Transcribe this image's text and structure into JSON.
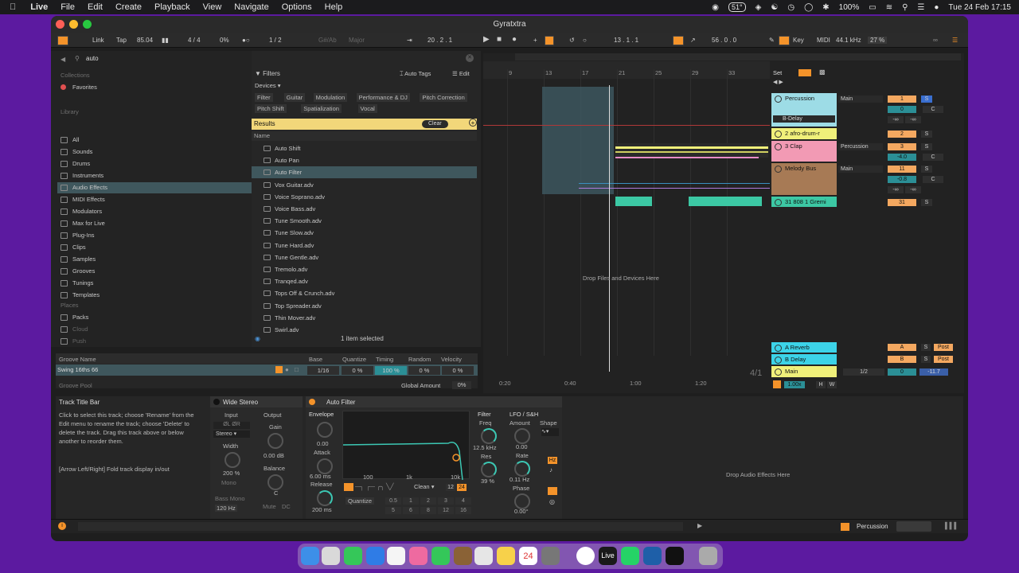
{
  "menubar": {
    "app": "Live",
    "items": [
      "File",
      "Edit",
      "Create",
      "Playback",
      "View",
      "Navigate",
      "Options",
      "Help"
    ],
    "temp": "51°",
    "battery": "100%",
    "datetime": "Tue 24 Feb  17:15"
  },
  "window": {
    "title": "Gyratxtra"
  },
  "transport": {
    "link": "Link",
    "tap": "Tap",
    "tempo": "85.04",
    "signature": "4 / 4",
    "groove_pct": "0%",
    "quant": "1 / 2",
    "key_ph": "G#/Ab",
    "scale": "Major",
    "pos1": "20 .  2 .  1",
    "pos2": "13 .  1 .  1",
    "pos3": "56 .  0 .  0",
    "key": "Key",
    "midi": "MIDI",
    "sample_rate": "44.1 kHz",
    "cpu": "27 %"
  },
  "browser": {
    "search": "auto",
    "collections_hdr": "Collections",
    "favorites": "Favorites",
    "library_hdr": "Library",
    "library": [
      "All",
      "Sounds",
      "Drums",
      "Instruments",
      "Audio Effects",
      "MIDI Effects",
      "Modulators",
      "Max for Live",
      "Plug-Ins",
      "Clips",
      "Samples",
      "Grooves",
      "Tunings",
      "Templates"
    ],
    "places_hdr": "Places",
    "places": [
      "Packs",
      "Cloud",
      "Push"
    ],
    "filters": "Filters",
    "auto_tags": "Auto Tags",
    "edit": "Edit",
    "devices_filter": "Devices",
    "tags1": [
      "Filter",
      "Guitar",
      "Modulation",
      "Performance & DJ",
      "Pitch Correction"
    ],
    "tags2": [
      "Pitch Shift",
      "Spatialization",
      "Vocal"
    ],
    "results": "Results",
    "clear": "Clear",
    "name_col": "Name",
    "results_list": [
      "Auto Shift",
      "Auto Pan",
      "Auto Filter",
      "Vox Guitar.adv",
      "Voice Soprano.adv",
      "Voice Bass.adv",
      "Tune Smooth.adv",
      "Tune Slow.adv",
      "Tune Hard.adv",
      "Tune Gentle.adv",
      "Tremolo.adv",
      "Tranqed.adv",
      "Tops Off & Crunch.adv",
      "Top Spreader.adv",
      "Thin Mover.adv",
      "Swirl.adv"
    ],
    "footer": "1 item selected"
  },
  "groove": {
    "hdr_name": "Groove Name",
    "hdr_base": "Base",
    "hdr_quantize": "Quantize",
    "hdr_timing": "Timing",
    "hdr_random": "Random",
    "hdr_velocity": "Velocity",
    "name": "Swing 16ths 66",
    "base": "1/16",
    "quantize": "0 %",
    "timing": "100 %",
    "random": "0 %",
    "velocity": "0 %",
    "pool": "Groove Pool",
    "global": "Global Amount",
    "global_val": "0%"
  },
  "arrangement": {
    "bars": [
      "9",
      "13",
      "17",
      "21",
      "25",
      "29",
      "33"
    ],
    "set": "Set",
    "drop_text": "Drop Files and Devices Here",
    "times": [
      "0:20",
      "0:40",
      "1:00",
      "1:20"
    ],
    "zoom": "4/1",
    "scale": "1.00x",
    "h": "H",
    "w": "W",
    "tracks": [
      {
        "name": "Percussion",
        "route": "Main",
        "num": "1",
        "vol": "0",
        "pan": "C",
        "inf1": "-∞",
        "inf2": "-∞",
        "sub": "B-Delay",
        "color": "#9ddce6"
      },
      {
        "name": "2 afro-drum-r",
        "num": "2",
        "color": "#f0f07a"
      },
      {
        "name": "3 Clap",
        "route": "Percussion",
        "num": "3",
        "vol": "-4.0",
        "pan": "C",
        "color": "#f29ab4"
      },
      {
        "name": "Melody Bus",
        "route": "Main",
        "num": "11",
        "vol": "-0.8",
        "pan": "C",
        "inf1": "-∞",
        "inf2": "-∞",
        "color": "#a77a55"
      },
      {
        "name": "31 808 1 Gremi",
        "num": "31",
        "color": "#3cc8a4"
      }
    ],
    "returns": [
      {
        "name": "A Reverb",
        "letter": "A",
        "post": "Post"
      },
      {
        "name": "B Delay",
        "letter": "B",
        "post": "Post"
      }
    ],
    "master": {
      "name": "Main",
      "quant": "1/2",
      "vol": "0",
      "peak": "-11.7"
    },
    "s": "S",
    "c": "C"
  },
  "help": {
    "title": "Track Title Bar",
    "body": "Click to select this track; choose 'Rename' from the Edit menu to rename the track; choose 'Delete' to delete the track. Drag this track above or below another to reorder them.",
    "hint": "[Arrow Left/Right] Fold track display in/out"
  },
  "wide_stereo": {
    "title": "Wide Stereo",
    "input": "Input",
    "output": "Output",
    "mode": "Stereo",
    "width": "Width",
    "width_val": "200 %",
    "mono": "Mono",
    "gain": "Gain",
    "gain_val": "0.00 dB",
    "balance": "Balance",
    "balance_val": "C",
    "bass_mono": "Bass Mono",
    "freq": "120 Hz",
    "mute": "Mute",
    "dc": "DC"
  },
  "auto_filter": {
    "title": "Auto Filter",
    "envelope": "Envelope",
    "env_val": "0.00",
    "attack": "Attack",
    "attack_val": "6.00 ms",
    "release": "Release",
    "release_val": "200 ms",
    "freq_ticks": [
      "100",
      "1k",
      "10k"
    ],
    "filter": "Filter",
    "freq": "Freq",
    "freq_val": "12.5 kHz",
    "res": "Res",
    "res_val": "39 %",
    "lfo": "LFO / S&H",
    "amount": "Amount",
    "amount_val": "0.00",
    "rate": "Rate",
    "rate_val": "0.11 Hz",
    "phase": "Phase",
    "phase_val": "0.00°",
    "shape": "Shape",
    "hz": "Hz",
    "clean": "Clean",
    "q12": "12",
    "q24": "24",
    "quantize": "Quantize",
    "qnums": [
      "0.5",
      "1",
      "2",
      "3",
      "4",
      "5",
      "6",
      "8",
      "12",
      "16"
    ]
  },
  "drop_audio": "Drop Audio Effects Here",
  "status": {
    "track": "Percussion"
  },
  "dock": {
    "live": "Live",
    "cal_day": "24"
  }
}
